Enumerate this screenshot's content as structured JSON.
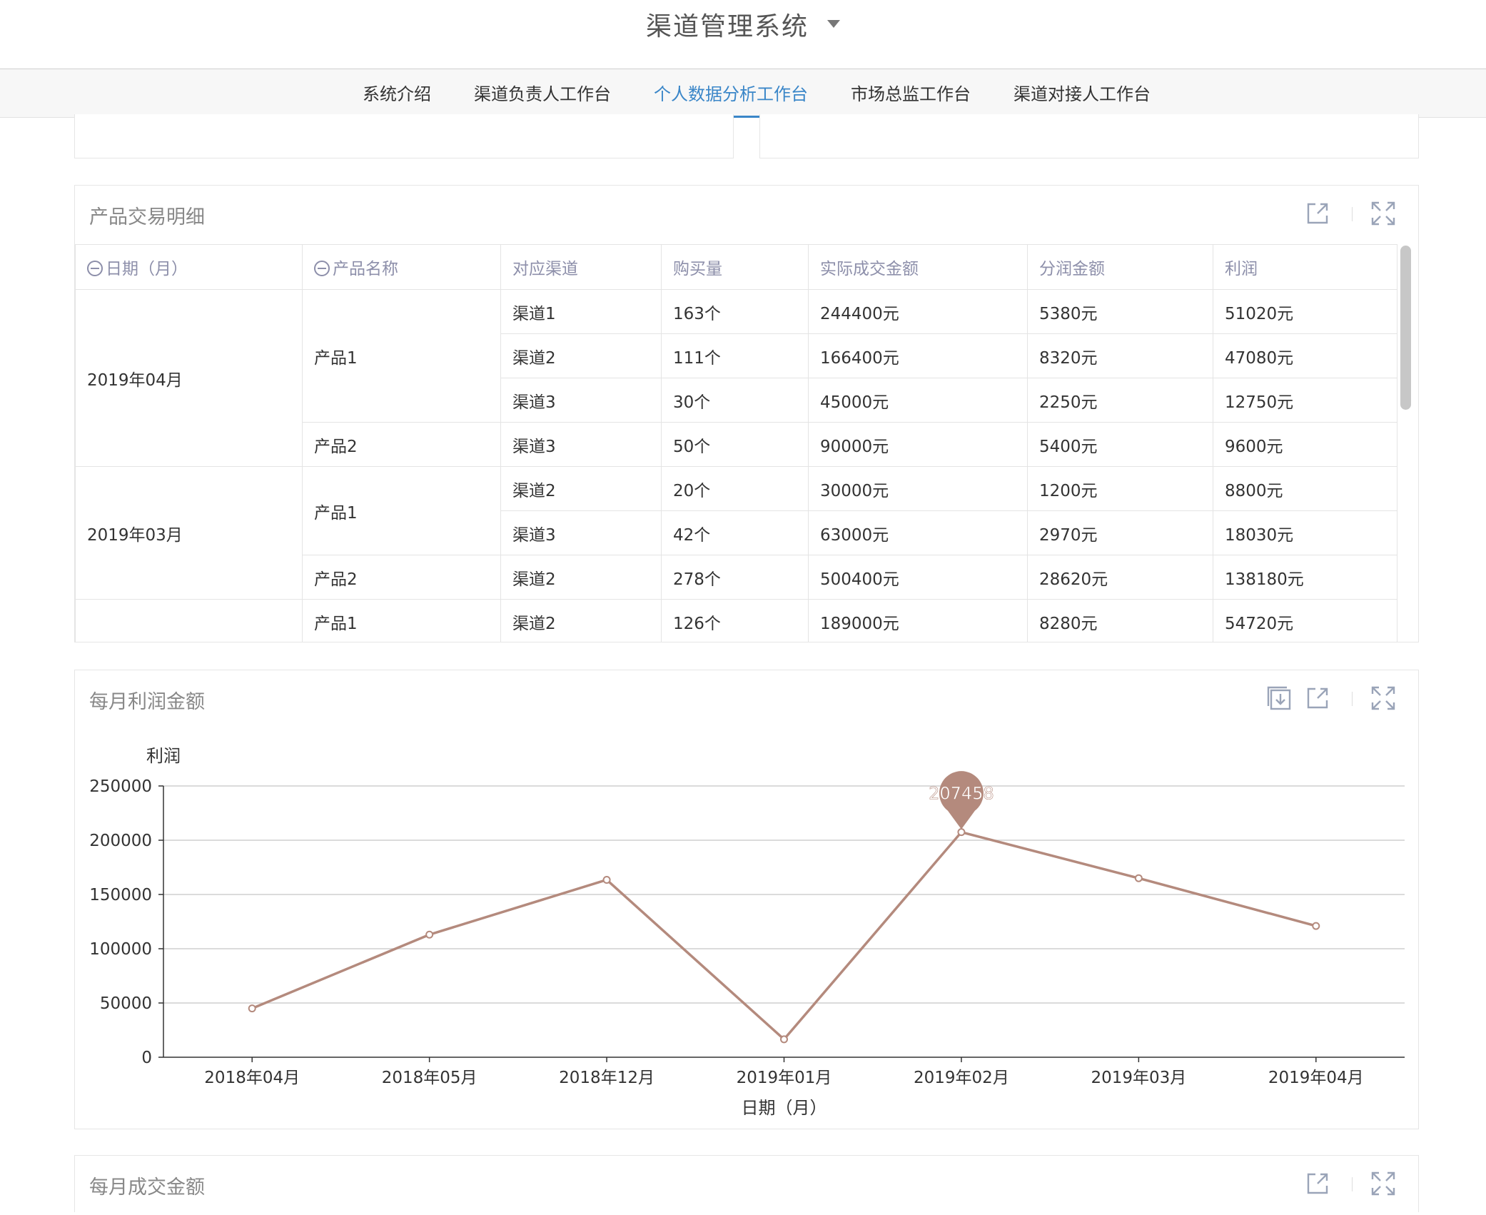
{
  "app": {
    "title": "渠道管理系统"
  },
  "nav": {
    "tabs": [
      "系统介绍",
      "渠道负责人工作台",
      "个人数据分析工作台",
      "市场总监工作台",
      "渠道对接人工作台"
    ],
    "active_index": 2
  },
  "colors": {
    "accent": "#3a86c8",
    "series": "#b48a7d",
    "header_text": "#8d8faa"
  },
  "table_panel": {
    "title": "产品交易明细",
    "columns": [
      "日期（月）",
      "产品名称",
      "对应渠道",
      "购买量",
      "实际成交金额",
      "分润金额",
      "利润"
    ],
    "groups": [
      {
        "date": "2019年04月",
        "products": [
          {
            "name": "产品1",
            "rows": [
              [
                "渠道1",
                "163个",
                "244400元",
                "5380元",
                "51020元"
              ],
              [
                "渠道2",
                "111个",
                "166400元",
                "8320元",
                "47080元"
              ],
              [
                "渠道3",
                "30个",
                "45000元",
                "2250元",
                "12750元"
              ]
            ]
          },
          {
            "name": "产品2",
            "rows": [
              [
                "渠道3",
                "50个",
                "90000元",
                "5400元",
                "9600元"
              ]
            ]
          }
        ]
      },
      {
        "date": "2019年03月",
        "products": [
          {
            "name": "产品1",
            "rows": [
              [
                "渠道2",
                "20个",
                "30000元",
                "1200元",
                "8800元"
              ],
              [
                "渠道3",
                "42个",
                "63000元",
                "2970元",
                "18030元"
              ]
            ]
          },
          {
            "name": "产品2",
            "rows": [
              [
                "渠道2",
                "278个",
                "500400元",
                "28620元",
                "138180元"
              ]
            ]
          }
        ]
      },
      {
        "date": "",
        "products": [
          {
            "name": "产品1",
            "rows": [
              [
                "渠道2",
                "126个",
                "189000元",
                "8280元",
                "54720元"
              ]
            ]
          }
        ]
      }
    ]
  },
  "chart_panel": {
    "title": "每月利润金额"
  },
  "chart_data": {
    "type": "line",
    "categories": [
      "2018年04月",
      "2018年05月",
      "2018年12月",
      "2019年01月",
      "2019年02月",
      "2019年03月",
      "2019年04月"
    ],
    "series": [
      {
        "values": [
          45000,
          113000,
          163500,
          16500,
          207458,
          165000,
          121000
        ]
      }
    ],
    "xlabel": "日期（月）",
    "ylabel": "利润",
    "ylim": [
      0,
      250000
    ],
    "yticks": [
      0,
      50000,
      100000,
      150000,
      200000,
      250000
    ],
    "grid": true,
    "marker": {
      "index": 4,
      "label": "207458"
    }
  },
  "next_panel": {
    "title": "每月成交金额"
  }
}
